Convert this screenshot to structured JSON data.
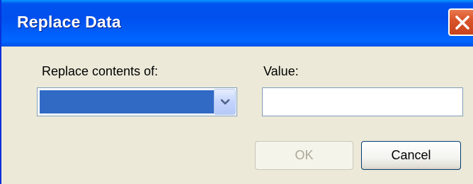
{
  "window": {
    "title": "Replace Data"
  },
  "form": {
    "replace_label": "Replace contents of:",
    "replace_selected": "",
    "value_label": "Value:",
    "value_text": ""
  },
  "buttons": {
    "ok_label": "OK",
    "ok_enabled": false,
    "cancel_label": "Cancel"
  },
  "icons": {
    "close": "close-icon",
    "dropdown": "chevron-down-icon"
  },
  "colors": {
    "titlebar": "#0054e3",
    "selection": "#316ac5",
    "close_button": "#d9552b",
    "dialog_background": "#ece9d8"
  }
}
